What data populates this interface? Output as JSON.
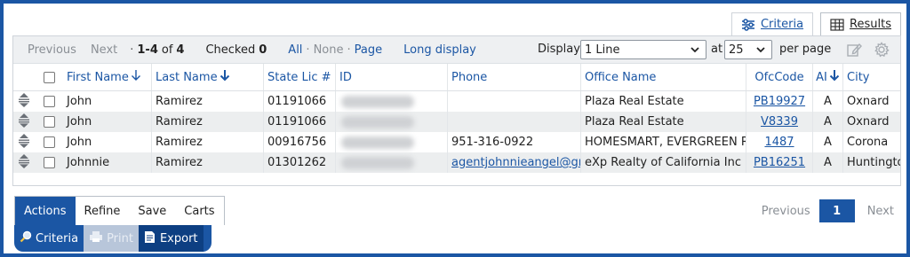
{
  "view_tabs": {
    "criteria": "Criteria",
    "results": "Results"
  },
  "toolbar": {
    "previous": "Previous",
    "next": "Next",
    "range": "1-4",
    "of": "of",
    "total": "4",
    "checked_label": "Checked",
    "checked_count": "0",
    "select_all": "All",
    "select_none": "None",
    "select_page": "Page",
    "long_display": "Long display",
    "display_label": "Display",
    "display_value": "1 Line",
    "at_label": "at",
    "per_page_value": "25",
    "per_page_label": "per page"
  },
  "columns": {
    "first_name": "First Name",
    "last_name": "Last Name",
    "state_lic": "State Lic #",
    "id": "ID",
    "phone": "Phone",
    "office_name": "Office Name",
    "ofc_code": "OfcCode",
    "ai": "AI",
    "city": "City"
  },
  "rows": [
    {
      "first": "John",
      "last": "Ramirez",
      "lic": "01191066",
      "phone": "",
      "office": "Plaza Real Estate",
      "ofc": "PB19927",
      "ai": "A",
      "city": "Oxnard"
    },
    {
      "first": "John",
      "last": "Ramirez",
      "lic": "01191066",
      "phone": "",
      "office": "Plaza Real Estate",
      "ofc": "V8339",
      "ai": "A",
      "city": "Oxnard"
    },
    {
      "first": "John",
      "last": "Ramirez",
      "lic": "00916756",
      "phone": "951-316-0922",
      "office": "HOMESMART, EVERGREEN REALT",
      "ofc": "1487",
      "ai": "A",
      "city": "Corona"
    },
    {
      "first": "Johnnie",
      "last": "Ramirez",
      "lic": "01301262",
      "phone": "agentjohnnieangel@gmail.com",
      "office": "eXp Realty of California Inc",
      "ofc": "PB16251",
      "ai": "A",
      "city": "Huntington"
    }
  ],
  "action_tabs": {
    "actions": "Actions",
    "refine": "Refine",
    "save": "Save",
    "carts": "Carts"
  },
  "action_buttons": {
    "criteria": "Criteria",
    "print": "Print",
    "export": "Export"
  },
  "pager": {
    "previous": "Previous",
    "current": "1",
    "next": "Next"
  },
  "colors": {
    "brand": "#1b56a4",
    "alt_row": "#eceeef",
    "toolbar_bg": "#eef0f2"
  }
}
